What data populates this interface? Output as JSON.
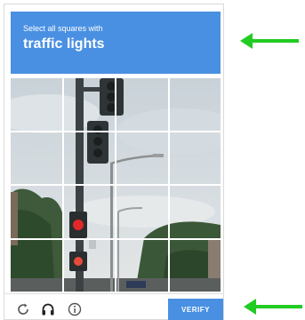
{
  "challenge": {
    "instruction": "Select all squares with",
    "target": "traffic lights"
  },
  "grid": {
    "rows": 4,
    "cols": 4
  },
  "footer": {
    "reload_icon": "reload-icon",
    "audio_icon": "headphones-icon",
    "info_icon": "info-icon",
    "verify_label": "VERIFY"
  },
  "colors": {
    "accent": "#4a90e2",
    "arrow": "#22cc22"
  }
}
